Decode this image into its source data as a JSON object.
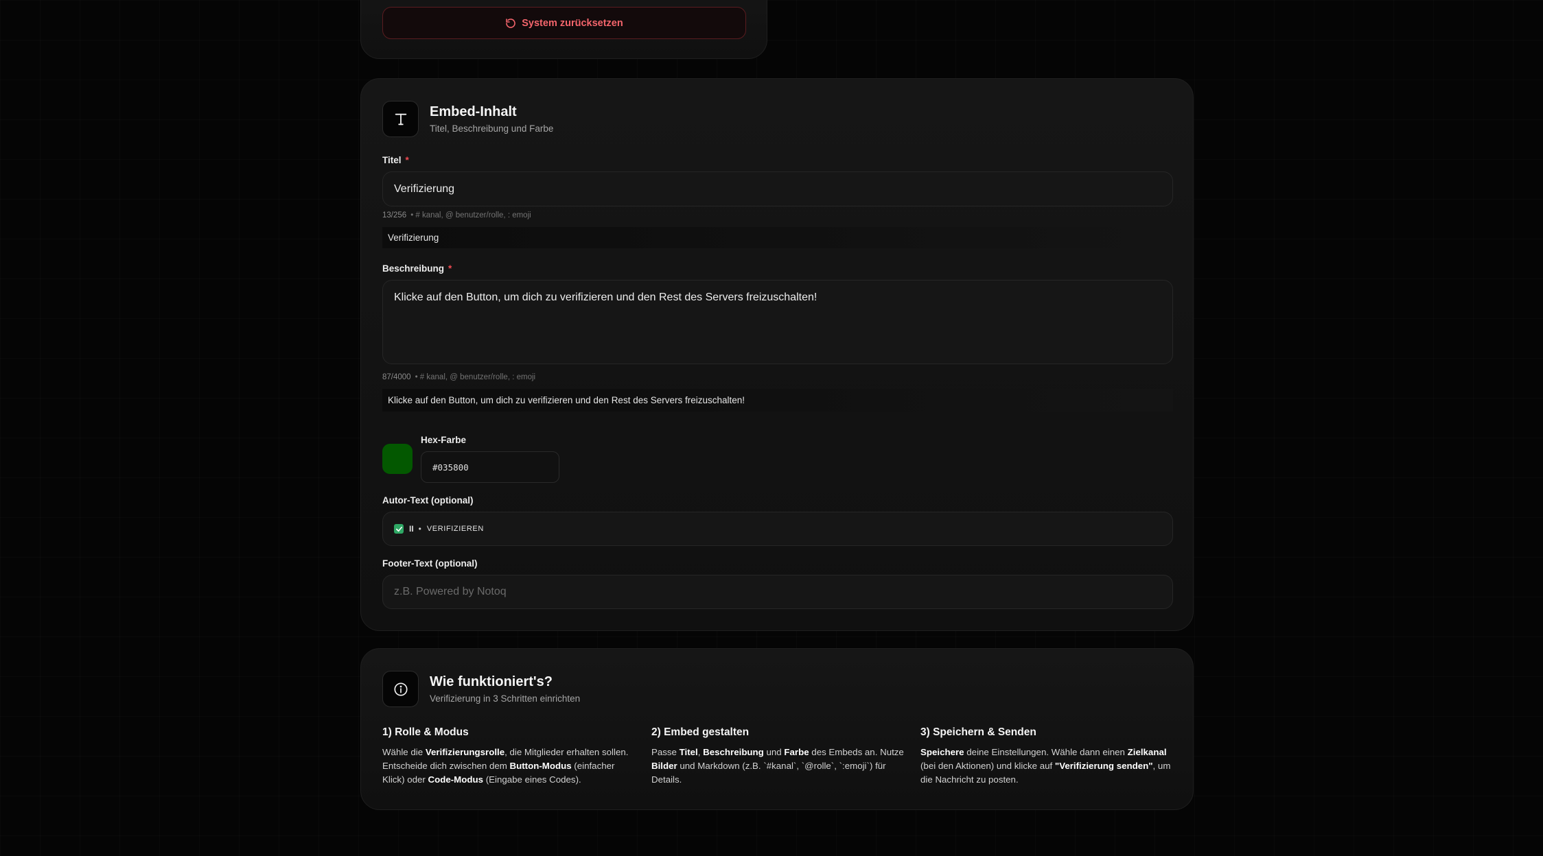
{
  "reset": {
    "label": "System zurücksetzen"
  },
  "embed": {
    "title": "Embed-Inhalt",
    "subtitle": "Titel, Beschreibung und Farbe",
    "title_field": {
      "label": "Titel",
      "required_mark": "*",
      "value": "Verifizierung",
      "counter": "13/256",
      "hint": "• # kanal, @ benutzer/rolle, : emoji",
      "preview": "Verifizierung"
    },
    "description_field": {
      "label": "Beschreibung",
      "required_mark": "*",
      "value": "Klicke auf den Button, um dich zu verifizieren und den Rest des Servers freizuschalten!",
      "counter": "87/4000",
      "hint": "• # kanal, @ benutzer/rolle, : emoji",
      "preview": "Klicke auf den Button, um dich zu verifizieren und den Rest des Servers freizuschalten!"
    },
    "color_field": {
      "label": "Hex-Farbe",
      "value": "#035800"
    },
    "author_field": {
      "label": "Autor-Text (optional)",
      "pause": "II",
      "dot": "•",
      "text": "VERIFIZIEREN"
    },
    "footer_field": {
      "label": "Footer-Text (optional)",
      "placeholder": "z.B. Powered by Notoq"
    }
  },
  "help": {
    "title": "Wie funktioniert's?",
    "subtitle": "Verifizierung in 3 Schritten einrichten",
    "steps": [
      {
        "title": "1) Rolle & Modus",
        "parts": [
          "Wähle die ",
          "Verifizierungsrolle",
          ", die Mitglieder erhalten sollen. Entscheide dich zwischen dem ",
          "Button-Modus",
          " (einfacher Klick) oder ",
          "Code-Modus",
          " (Eingabe eines Codes)."
        ]
      },
      {
        "title": "2) Embed gestalten",
        "parts": [
          "Passe ",
          "Titel",
          ", ",
          "Beschreibung",
          " und ",
          "Farbe",
          " des Embeds an. Nutze ",
          "Bilder",
          " und Markdown (z.B. `#kanal`, `@rolle`, `:emoji`) für Details."
        ]
      },
      {
        "title": "3) Speichern & Senden",
        "parts": [
          "Speichere",
          " deine Einstellungen. Wähle dann einen ",
          "Zielkanal",
          " (bei den Aktionen) und klicke auf ",
          "\"Verifizierung senden\"",
          ", um die Nachricht zu posten."
        ]
      }
    ]
  },
  "colors": {
    "accent_red": "#f4656c",
    "embed_color": "#035800",
    "check_green": "#2fa865"
  }
}
